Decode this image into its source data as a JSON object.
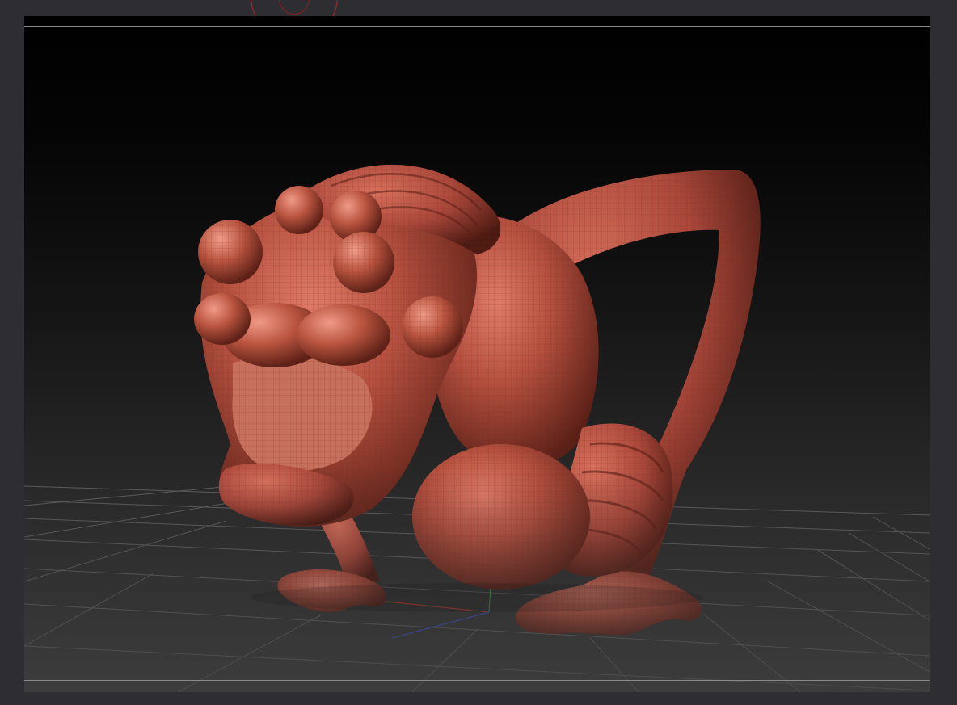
{
  "app": {
    "viewport_label": "",
    "model_name": ""
  },
  "colors": {
    "frame": "#2e2e32",
    "viewport_top": "#000000",
    "viewport_bottom": "#3a3a3a",
    "sculpt_material": "#b5503f",
    "brush_ring": "#b0262a",
    "grid_line": "#6f6f6f",
    "axis_x": "#c23b30",
    "axis_y": "#2fae3a",
    "axis_z": "#3a4fc0"
  },
  "icons": {
    "brush_cursor": "draw-brush-ring-icon",
    "axis_gizmo": "axis-gizmo-icon"
  }
}
